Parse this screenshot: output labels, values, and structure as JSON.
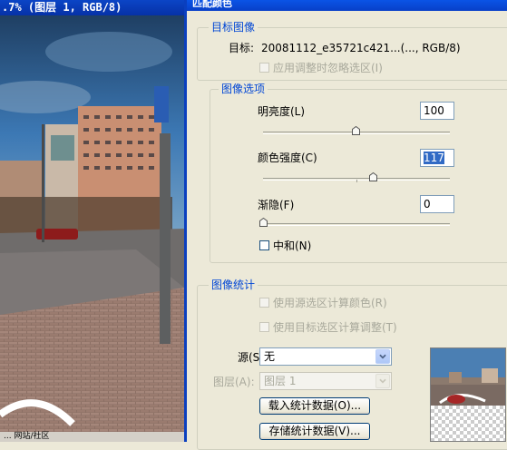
{
  "document": {
    "title": ".7% (图层 1, RGB/8)",
    "status": "... 网站/社区"
  },
  "dialog": {
    "title": "匹配颜色",
    "target_group": {
      "legend": "目标图像",
      "target_label": "目标:",
      "target_value": "20081112_e35721c421...(..., RGB/8)",
      "ignore_selection_label": "应用调整时忽略选区(I)"
    },
    "image_options": {
      "legend": "图像选项",
      "luminance_label": "明亮度(L)",
      "luminance_value": "100",
      "luminance_level": 0.5,
      "color_intensity_label": "颜色强度(C)",
      "color_intensity_value": "117",
      "color_intensity_level": 0.585,
      "fade_label": "渐隐(F)",
      "fade_value": "0",
      "fade_level": 0,
      "neutralize_label": "中和(N)"
    },
    "image_statistics": {
      "legend": "图像统计",
      "use_source_selection_label": "使用源选区计算颜色(R)",
      "use_target_selection_label": "使用目标选区计算调整(T)",
      "source_label": "源(S):",
      "source_value": "无",
      "layer_label": "图层(A):",
      "layer_value": "图层 1",
      "load_stats_button": "载入统计数据(O)...",
      "save_stats_button": "存储统计数据(V)..."
    },
    "colors": {
      "title_bar": "#0a54e6",
      "legend_text": "#0046d5",
      "selection": "#316ac5"
    }
  }
}
